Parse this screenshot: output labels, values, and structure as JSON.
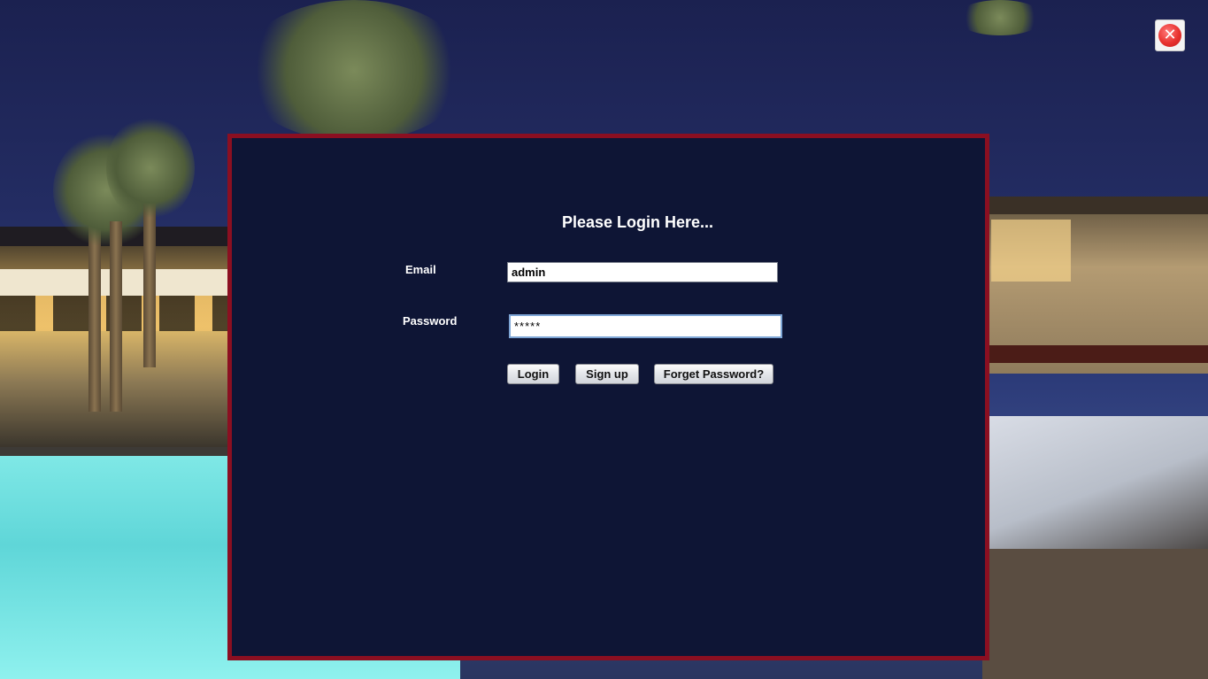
{
  "window": {
    "close_icon": "close-icon",
    "close_color": "#e8322f"
  },
  "login": {
    "title": "Please Login Here...",
    "email_label": "Email",
    "email_value": "admin",
    "password_label": "Password",
    "password_value": "*****",
    "buttons": {
      "login": "Login",
      "signup": "Sign up",
      "forget": "Forget Password?"
    }
  },
  "theme": {
    "panel_background": "#0e1535",
    "panel_border": "#8b0f21",
    "text_color": "#ffffff"
  }
}
